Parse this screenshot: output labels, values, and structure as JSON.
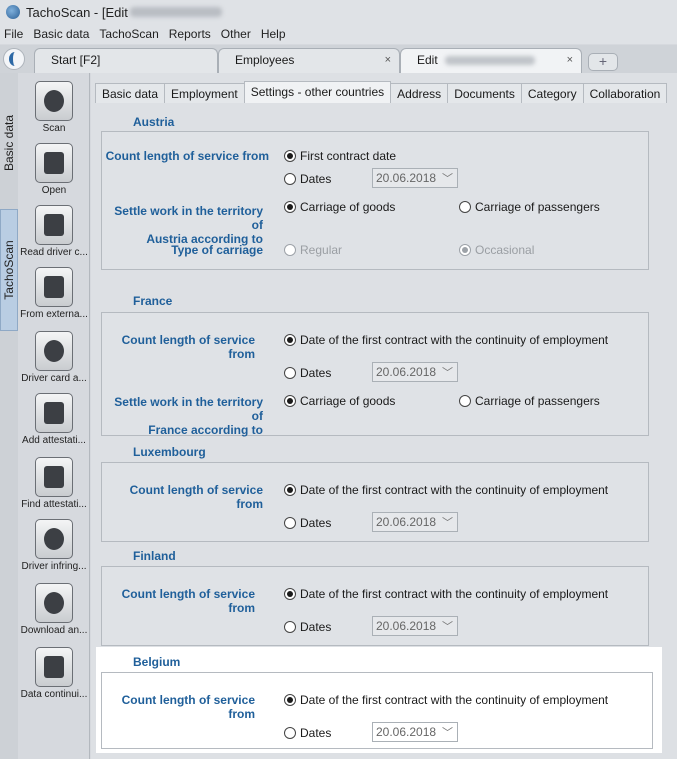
{
  "window": {
    "title": "TachoScan - [Edit"
  },
  "menu": [
    "File",
    "Basic data",
    "TachoScan",
    "Reports",
    "Other",
    "Help"
  ],
  "doc_tabs": {
    "start": "Start [F2]",
    "employees": "Employees",
    "edit": "Edit",
    "close": "×",
    "add_icon": "plus-icon"
  },
  "left_tabs": {
    "basic_data": "Basic data",
    "tachoscan": "TachoScan"
  },
  "tools": [
    "Scan",
    "Open",
    "Read driver c...",
    "From externa...",
    "Driver card a...",
    "Add attestati...",
    "Find attestati...",
    "Driver infring...",
    "Download an...",
    "Data continui..."
  ],
  "subtabs": [
    "Basic data",
    "Employment",
    "Settings - other countries",
    "Address",
    "Documents",
    "Category",
    "Collaboration"
  ],
  "active_subtab": "Settings - other countries",
  "austria": {
    "title": "Austria",
    "count_label": "Count length of service from",
    "opt_first": "First contract date",
    "opt_dates": "Dates",
    "date": "20.06.2018",
    "settle_label_1": "Settle work in the territory of",
    "settle_label_2": "Austria according to",
    "goods": "Carriage of goods",
    "passengers": "Carriage of passengers",
    "carriage_label": "Type of carriage",
    "regular": "Regular",
    "occasional": "Occasional"
  },
  "france": {
    "title": "France",
    "count_label": "Count length of service from",
    "opt_first": "Date of the first contract with the continuity of employment",
    "opt_dates": "Dates",
    "date": "20.06.2018",
    "settle_label_1": "Settle work in the territory of",
    "settle_label_2": "France according to",
    "goods": "Carriage of goods",
    "passengers": "Carriage of passengers"
  },
  "luxembourg": {
    "title": "Luxembourg",
    "count_label": "Count length of service from",
    "opt_first": "Date of the first contract with the continuity of employment",
    "opt_dates": "Dates",
    "date": "20.06.2018"
  },
  "finland": {
    "title": "Finland",
    "count_label": "Count length of service from",
    "opt_first": "Date of the first contract with the continuity of employment",
    "opt_dates": "Dates",
    "date": "20.06.2018"
  },
  "belgium": {
    "title": "Belgium",
    "count_label": "Count length of service from",
    "opt_first": "Date of the first contract with the continuity of employment",
    "opt_dates": "Dates",
    "date": "20.06.2018"
  },
  "colors": {
    "label_blue": "#1f5f9a",
    "highlight": "#ffffff",
    "dim_bg": "#dde0e4"
  }
}
